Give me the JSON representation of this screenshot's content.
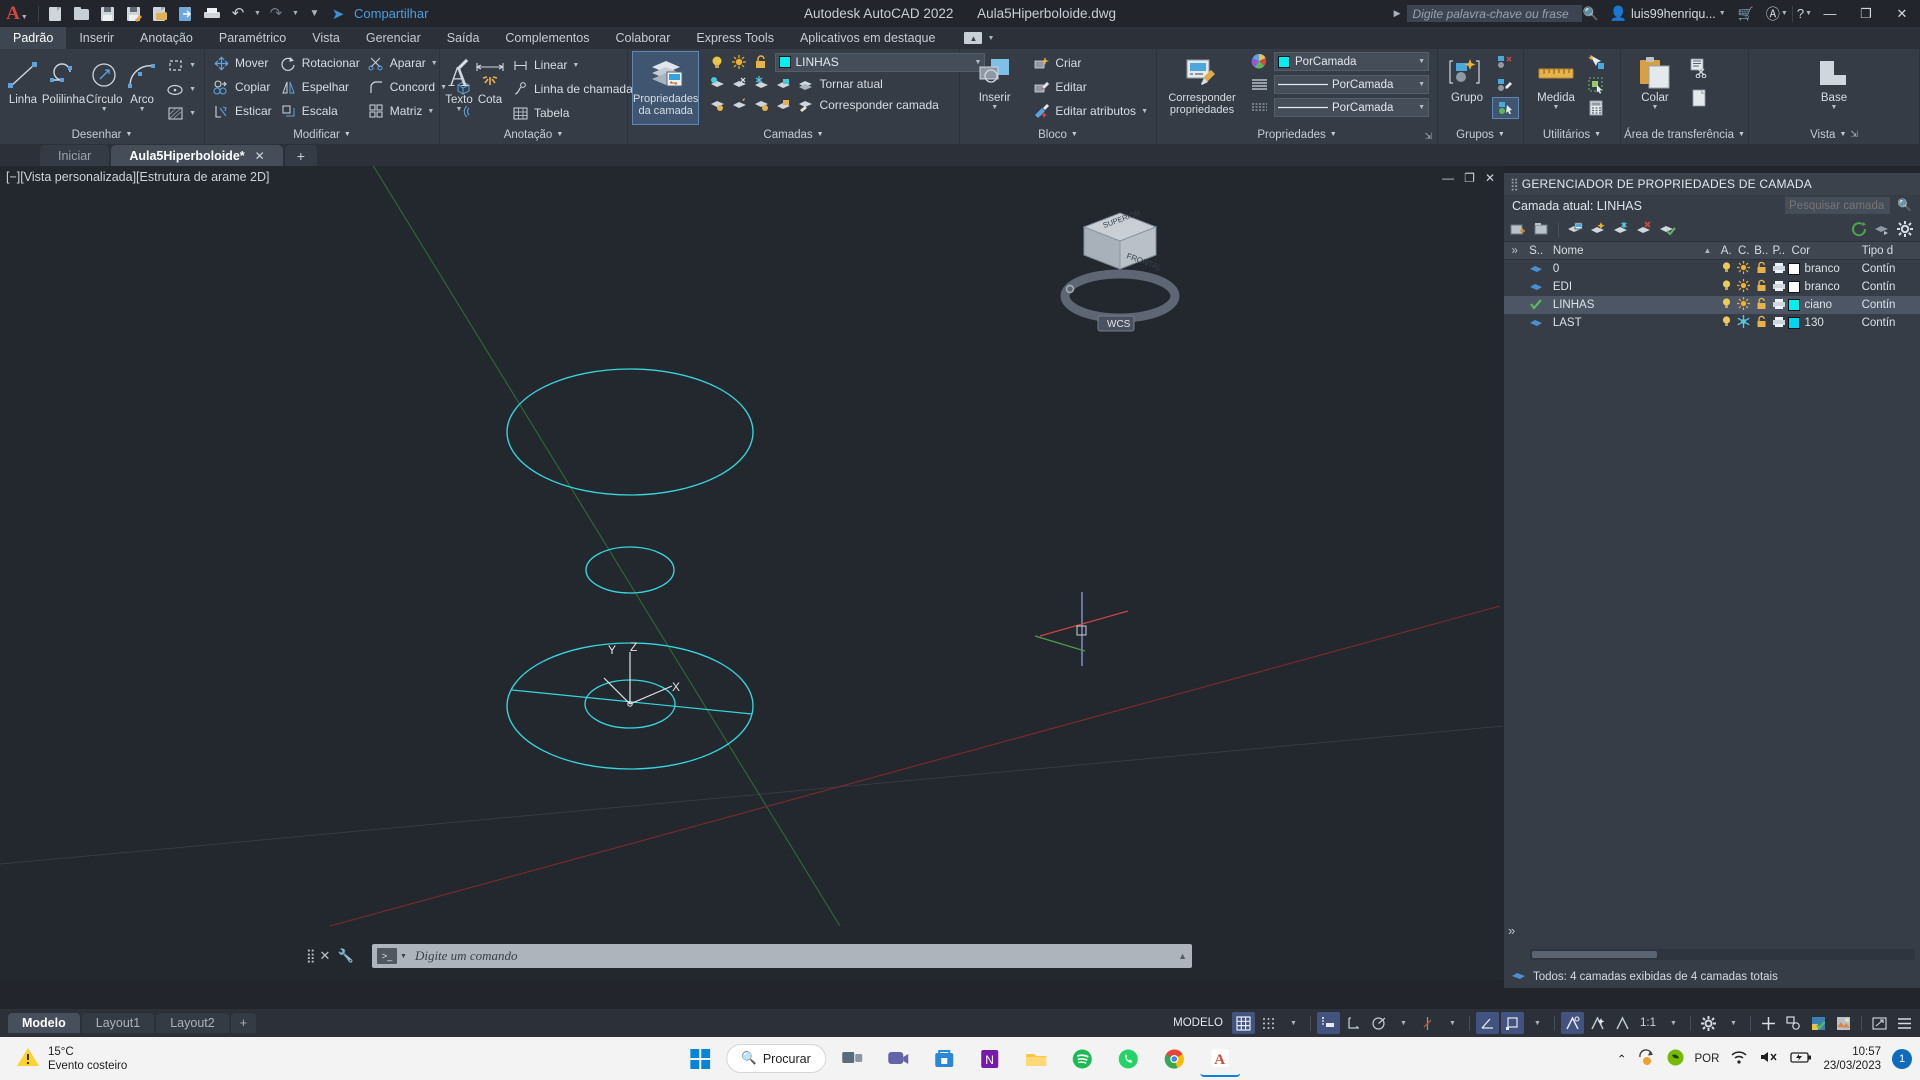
{
  "titlebar": {
    "logo": "A",
    "quick_access": [
      {
        "name": "new-file-icon",
        "label": "Novo"
      },
      {
        "name": "open-file-icon",
        "label": "Abrir"
      },
      {
        "name": "save-icon",
        "label": "Salvar"
      },
      {
        "name": "save-as-icon",
        "label": "Salvar como"
      },
      {
        "name": "export-icon",
        "label": "Exportar"
      },
      {
        "name": "cloud-sync-icon",
        "label": "Sincronizar"
      },
      {
        "name": "plot-icon",
        "label": "Plotar"
      },
      {
        "name": "undo-icon",
        "label": "Desfazer"
      },
      {
        "name": "redo-icon",
        "label": "Refazer"
      }
    ],
    "share_label": "Compartilhar",
    "app_name": "Autodesk AutoCAD 2022",
    "document_name": "Aula5Hiperboloide.dwg",
    "search_placeholder": "Digite palavra-chave ou frase",
    "username": "luis99henriqu...",
    "window_buttons": {
      "minimize": "—",
      "restore": "❐",
      "close": "✕"
    }
  },
  "menubar": {
    "tabs": [
      {
        "label": "Padrão",
        "active": true
      },
      {
        "label": "Inserir",
        "active": false
      },
      {
        "label": "Anotação",
        "active": false
      },
      {
        "label": "Paramétrico",
        "active": false
      },
      {
        "label": "Vista",
        "active": false
      },
      {
        "label": "Gerenciar",
        "active": false
      },
      {
        "label": "Saída",
        "active": false
      },
      {
        "label": "Complementos",
        "active": false
      },
      {
        "label": "Colaborar",
        "active": false
      },
      {
        "label": "Express Tools",
        "active": false
      },
      {
        "label": "Aplicativos em destaque",
        "active": false
      }
    ]
  },
  "ribbon": {
    "panels": [
      {
        "title": "Desenhar",
        "big": [
          {
            "label": "Linha",
            "icon": "line-icon"
          },
          {
            "label": "Polilinha",
            "icon": "polyline-icon"
          },
          {
            "label": "Círculo",
            "icon": "circle-icon",
            "dropdown": true
          },
          {
            "label": "Arco",
            "icon": "arc-icon",
            "dropdown": true
          }
        ],
        "small": [
          {
            "label": "",
            "icon": "rectangle-icon",
            "dropdown": true
          },
          {
            "label": "",
            "icon": "ellipse-icon",
            "dropdown": true
          },
          {
            "label": "",
            "icon": "hatch-icon",
            "dropdown": true
          }
        ]
      },
      {
        "title": "Modificar",
        "items": [
          {
            "label": "Mover",
            "icon": "move-icon"
          },
          {
            "label": "Rotacionar",
            "icon": "rotate-icon"
          },
          {
            "label": "Aparar",
            "icon": "trim-icon",
            "dropdown": true
          },
          {
            "label": "Copiar",
            "icon": "copy-icon"
          },
          {
            "label": "Espelhar",
            "icon": "mirror-icon"
          },
          {
            "label": "Concord",
            "icon": "fillet-icon",
            "dropdown": true
          },
          {
            "label": "Esticar",
            "icon": "stretch-icon"
          },
          {
            "label": "Escala",
            "icon": "scale-icon"
          },
          {
            "label": "Matriz",
            "icon": "array-icon",
            "dropdown": true
          }
        ],
        "extras": [
          {
            "icon": "pencil-edit-icon"
          },
          {
            "icon": "3d-box-icon"
          },
          {
            "icon": "offset-icon"
          }
        ]
      },
      {
        "title": "Anotação",
        "big": [
          {
            "label": "Texto",
            "icon": "text-icon",
            "dropdown": true
          },
          {
            "label": "Cota",
            "icon": "dimension-icon",
            "dropdown": true
          }
        ],
        "small": [
          {
            "label": "Linear",
            "icon": "linear-dim-icon",
            "dropdown": true
          },
          {
            "label": "Linha de chamada",
            "icon": "leader-icon",
            "dropdown": true
          },
          {
            "label": "Tabela",
            "icon": "table-icon"
          }
        ]
      },
      {
        "title": "Camadas",
        "big": [
          {
            "label": "Propriedades\nda camada",
            "icon": "layer-properties-icon",
            "active": true
          }
        ],
        "current_layer": "LINHAS",
        "layer_color": "#00f0f0",
        "rows": [
          {
            "label": "Tornar atual",
            "icon": "make-current-icon"
          },
          {
            "label": "Corresponder camada",
            "icon": "match-layer-icon"
          }
        ]
      },
      {
        "title": "Bloco",
        "big": [
          {
            "label": "Inserir",
            "icon": "insert-block-icon",
            "dropdown": true
          }
        ],
        "small": [
          {
            "label": "Criar",
            "icon": "create-block-icon"
          },
          {
            "label": "Editar",
            "icon": "edit-block-icon"
          },
          {
            "label": "Editar atributos",
            "icon": "edit-attributes-icon",
            "dropdown": true
          }
        ]
      },
      {
        "title": "Propriedades",
        "big": [
          {
            "label": "Corresponder\npropriedades",
            "icon": "match-properties-icon"
          }
        ],
        "combos": [
          {
            "value": "PorCamada",
            "icon": "color-wheel-icon",
            "swatch": "#00f0f0"
          },
          {
            "value": "PorCamada",
            "icon": "linetype-icon"
          },
          {
            "value": "PorCamada",
            "icon": "lineweight-icon"
          }
        ]
      },
      {
        "title": "Grupos",
        "big": [
          {
            "label": "Grupo",
            "icon": "group-icon"
          }
        ],
        "small": [
          {
            "icon": "ungroup-icon"
          },
          {
            "icon": "group-edit-icon"
          },
          {
            "icon": "group-selection-icon",
            "active": true
          }
        ]
      },
      {
        "title": "Utilitários",
        "big": [
          {
            "label": "Medida",
            "icon": "measure-icon",
            "dropdown": true
          }
        ],
        "small": [
          {
            "icon": "quick-select-icon"
          },
          {
            "icon": "select-all-icon"
          },
          {
            "icon": "calculator-icon"
          }
        ]
      },
      {
        "title": "Área de transferência",
        "big": [
          {
            "label": "Colar",
            "icon": "paste-icon",
            "dropdown": true
          }
        ],
        "small": [
          {
            "icon": "cut-icon"
          },
          {
            "icon": "copy-clip-icon"
          }
        ]
      },
      {
        "title": "Vista",
        "big": [
          {
            "label": "Base",
            "icon": "base-view-icon",
            "dropdown": true
          }
        ]
      }
    ]
  },
  "filetabs": {
    "tabs": [
      {
        "label": "Iniciar",
        "active": false,
        "closable": false
      },
      {
        "label": "Aula5Hiperboloide*",
        "active": true,
        "closable": true
      }
    ],
    "add_label": "+"
  },
  "canvas": {
    "viewport_label": "[−][Vista personalizada][Estrutura de arame 2D]",
    "window_buttons": {
      "minimize": "—",
      "restore": "❐",
      "close": "✕"
    },
    "ucs_labels": {
      "x": "X",
      "y": "Y",
      "z": "Z"
    },
    "viewcube": {
      "top": "SUPERIOR",
      "front": "FRONTAL",
      "wcs": "WCS"
    },
    "command_placeholder": "Digite um comando",
    "geometry_color": "#35d6dd",
    "background": "#23272e"
  },
  "palette": {
    "title": "GERENCIADOR DE PROPRIEDADES DE CAMADA",
    "current_layer_label": "Camada atual: LINHAS",
    "search_placeholder": "Pesquisar camada",
    "columns": [
      "S..",
      "Nome",
      "A.",
      "C.",
      "B..",
      "P..",
      "Cor",
      "Tipo d"
    ],
    "rows": [
      {
        "status": "layer",
        "name": "0",
        "on": true,
        "freeze": false,
        "lock": false,
        "plot": true,
        "color_name": "branco",
        "color_hex": "#ffffff",
        "linetype": "Contín"
      },
      {
        "status": "layer",
        "name": "EDI",
        "on": true,
        "freeze": false,
        "lock": false,
        "plot": true,
        "color_name": "branco",
        "color_hex": "#ffffff",
        "linetype": "Contín"
      },
      {
        "status": "current",
        "name": "LINHAS",
        "on": true,
        "freeze": false,
        "lock": false,
        "plot": true,
        "color_name": "ciano",
        "color_hex": "#00f0f0",
        "linetype": "Contín",
        "selected": true
      },
      {
        "status": "layer",
        "name": "LAST",
        "on": true,
        "freeze": true,
        "lock": false,
        "plot": true,
        "color_name": "130",
        "color_hex": "#00d8f0",
        "linetype": "Contín"
      }
    ],
    "footer": "Todos: 4 camadas exibidas de 4 camadas totais",
    "tools": [
      {
        "icon": "new-layer-icon"
      },
      {
        "icon": "new-layer-frozen-icon"
      },
      {
        "icon": "delete-layer-icon"
      },
      {
        "icon": "set-current-icon"
      },
      {
        "icon": "layer-states-icon"
      },
      {
        "icon": "isolate-layer-icon"
      },
      {
        "icon": "freeze-layer-icon"
      },
      {
        "icon": "refresh-icon"
      },
      {
        "icon": "settings-icon"
      }
    ]
  },
  "statusbar": {
    "layout_tabs": [
      {
        "label": "Modelo",
        "active": true
      },
      {
        "label": "Layout1",
        "active": false
      },
      {
        "label": "Layout2",
        "active": false
      }
    ],
    "add_layout": "+",
    "space_label": "MODELO",
    "scale": "1:1",
    "toggles": [
      {
        "name": "grid-display",
        "icon": "grid-icon",
        "on": true
      },
      {
        "name": "snap-mode",
        "icon": "snap-icon",
        "on": false
      },
      {
        "name": "infer-constraints",
        "icon": "infer-icon",
        "on": true
      },
      {
        "name": "ortho-mode",
        "icon": "ortho-icon",
        "on": false
      },
      {
        "name": "polar-tracking",
        "icon": "polar-icon",
        "on": false
      },
      {
        "name": "object-snap-tracking",
        "icon": "otrack-icon",
        "on": false
      },
      {
        "name": "object-snap",
        "icon": "osnap-icon",
        "on": true
      },
      {
        "name": "dynamic-ucs",
        "icon": "ducs-icon",
        "on": false
      },
      {
        "name": "lineweight",
        "icon": "lineweight-status-icon",
        "on": true
      },
      {
        "name": "transparency",
        "icon": "transparency-icon",
        "on": false
      },
      {
        "name": "selection-cycling",
        "icon": "selcycle-icon",
        "on": false
      }
    ]
  },
  "taskbar": {
    "weather": {
      "temperature": "15°C",
      "condition": "Evento costeiro"
    },
    "search_label": "Procurar",
    "apps": [
      {
        "name": "start-button",
        "label": "Iniciar"
      },
      {
        "name": "task-view-button",
        "label": "Visão de tarefas"
      },
      {
        "name": "teams-app",
        "label": "Teams"
      },
      {
        "name": "store-app",
        "label": "Microsoft Store"
      },
      {
        "name": "onenote-app",
        "label": "OneNote"
      },
      {
        "name": "explorer-app",
        "label": "Explorador de Arquivos"
      },
      {
        "name": "spotify-app",
        "label": "Spotify"
      },
      {
        "name": "whatsapp-app",
        "label": "WhatsApp"
      },
      {
        "name": "chrome-app",
        "label": "Google Chrome"
      },
      {
        "name": "autocad-app",
        "label": "AutoCAD"
      }
    ],
    "tray": {
      "language": "POR",
      "time": "10:57",
      "date": "23/03/2023",
      "notification_count": "1"
    }
  }
}
